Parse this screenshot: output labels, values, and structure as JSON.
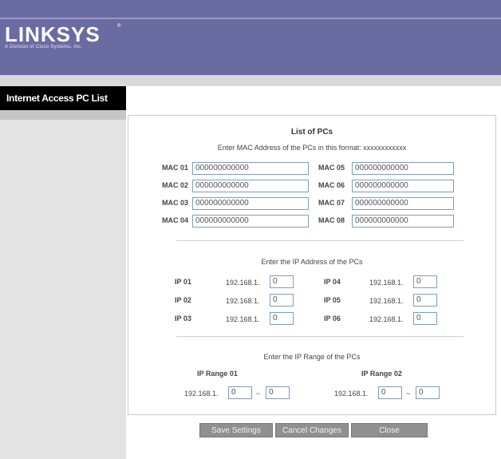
{
  "brand": {
    "logo": "LINKSYS",
    "trademark": "®",
    "tagline": "A Division of Cisco Systems, Inc."
  },
  "sidebar": {
    "title": "Internet Access PC List"
  },
  "main": {
    "title": "List of PCs",
    "mac_instruction": "Enter MAC Address of the PCs in this format: xxxxxxxxxxxx",
    "mac": [
      {
        "label": "MAC 01",
        "value": "000000000000"
      },
      {
        "label": "MAC 02",
        "value": "000000000000"
      },
      {
        "label": "MAC 03",
        "value": "000000000000"
      },
      {
        "label": "MAC 04",
        "value": "000000000000"
      },
      {
        "label": "MAC 05",
        "value": "000000000000"
      },
      {
        "label": "MAC 06",
        "value": "000000000000"
      },
      {
        "label": "MAC 07",
        "value": "000000000000"
      },
      {
        "label": "MAC 08",
        "value": "000000000000"
      }
    ],
    "ip_instruction": "Enter the IP Address of the PCs",
    "ip_prefix": "192.168.1.",
    "ip": [
      {
        "label": "IP 01",
        "value": "0"
      },
      {
        "label": "IP 02",
        "value": "0"
      },
      {
        "label": "IP 03",
        "value": "0"
      },
      {
        "label": "IP 04",
        "value": "0"
      },
      {
        "label": "IP 05",
        "value": "0"
      },
      {
        "label": "IP 06",
        "value": "0"
      }
    ],
    "range_instruction": "Enter the IP Range of the PCs",
    "range_separator": "~",
    "ranges": [
      {
        "label": "IP Range 01",
        "start": "0",
        "end": "0"
      },
      {
        "label": "IP Range 02",
        "start": "0",
        "end": "0"
      }
    ]
  },
  "buttons": {
    "save": "Save Settings",
    "cancel": "Cancel Changes",
    "close": "Close"
  }
}
